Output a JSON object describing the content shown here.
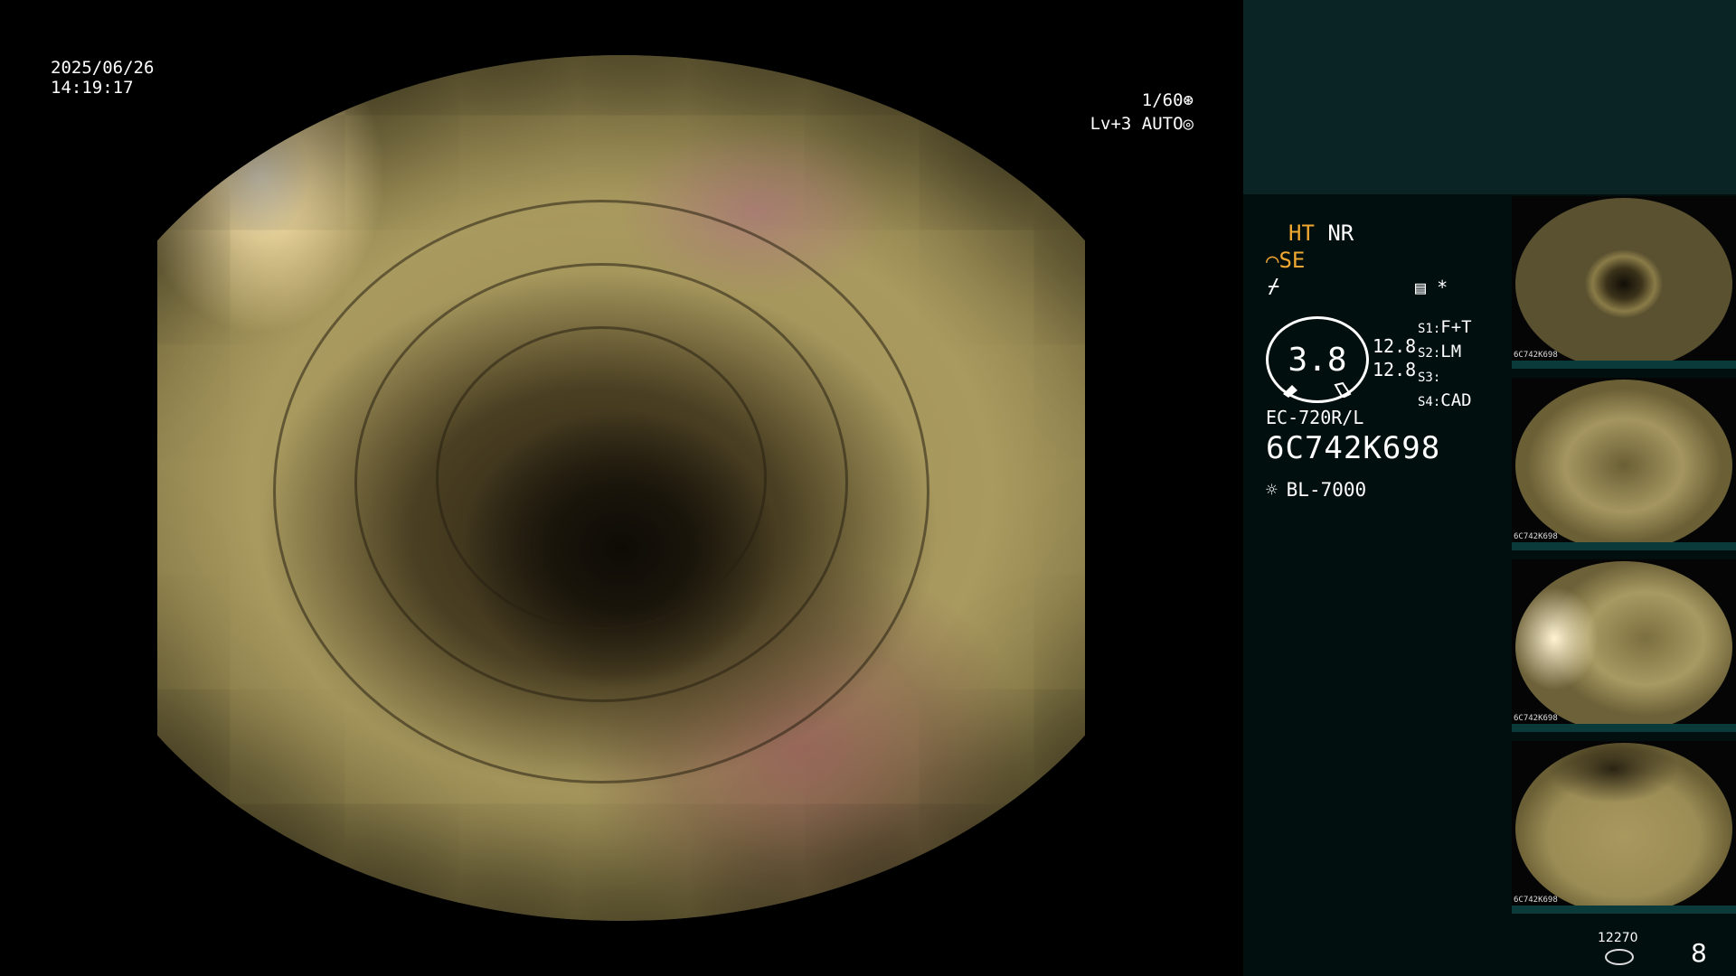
{
  "overlay": {
    "date": "2025/06/26",
    "time": "14:19:17",
    "shutter": "1/60",
    "level": "Lv+3",
    "auto": "AUTO"
  },
  "panel": {
    "ht": "HT",
    "nr": "NR",
    "se": "SE",
    "dial_value": "3.8",
    "value_1": "12.8",
    "value_2": "12.8",
    "slots": [
      {
        "key": "S1:",
        "value": "F+T"
      },
      {
        "key": "S2:",
        "value": "LM"
      },
      {
        "key": "S3:",
        "value": ""
      },
      {
        "key": "S4:",
        "value": "CAD"
      }
    ],
    "scope_model": "EC-720R/L",
    "serial": "6C742K698",
    "light_source": "BL-7000",
    "star": "*"
  },
  "thumbnails": [
    {
      "id": "6C742K698"
    },
    {
      "id": "6C742K698"
    },
    {
      "id": "6C742K698"
    },
    {
      "id": "6C742K698"
    }
  ],
  "footer": {
    "storage_count": "12270",
    "page_number": "8"
  },
  "icons": {
    "shutter": "aperture-icon",
    "auto": "iris-icon",
    "se": "tool-icon",
    "flash": "flash-off-icon",
    "menu": "memo-icon",
    "light": "light-source-icon",
    "storage": "disk-icon"
  }
}
